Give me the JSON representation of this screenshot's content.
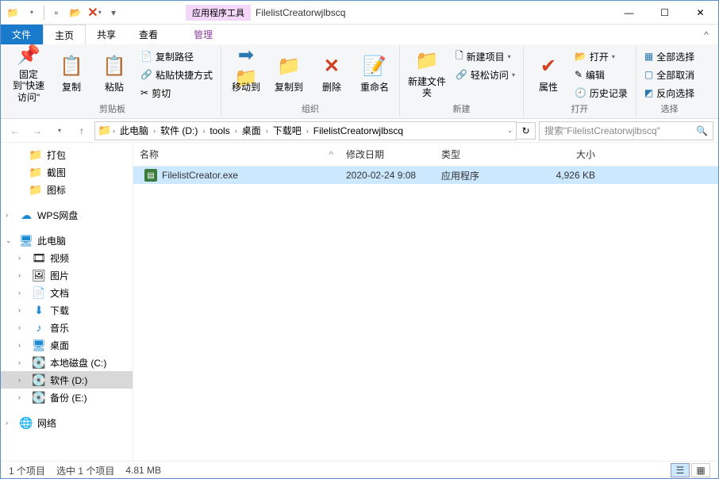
{
  "titlebar": {
    "tools_label": "应用程序工具",
    "title": "FilelistCreatorwjlbscq"
  },
  "tabs": {
    "file": "文件",
    "home": "主页",
    "share": "共享",
    "view": "查看",
    "manage": "管理"
  },
  "ribbon": {
    "pin": "固定到\"快速访问\"",
    "copy": "复制",
    "paste": "粘贴",
    "copy_path": "复制路径",
    "paste_shortcut": "粘贴快捷方式",
    "cut": "剪切",
    "clipboard_group": "剪贴板",
    "move_to": "移动到",
    "copy_to": "复制到",
    "delete": "删除",
    "rename": "重命名",
    "organize_group": "组织",
    "new_folder": "新建文件夹",
    "new_item": "新建项目",
    "easy_access": "轻松访问",
    "new_group": "新建",
    "properties": "属性",
    "open": "打开",
    "edit": "编辑",
    "history": "历史记录",
    "open_group": "打开",
    "select_all": "全部选择",
    "select_none": "全部取消",
    "invert": "反向选择",
    "select_group": "选择"
  },
  "breadcrumb": [
    "此电脑",
    "软件 (D:)",
    "tools",
    "桌面",
    "下载吧",
    "FilelistCreatorwjlbscq"
  ],
  "search": {
    "placeholder": "搜索\"FilelistCreatorwjlbscq\""
  },
  "nav": {
    "dabao": "打包",
    "jietu": "截图",
    "tubiao": "图标",
    "wps": "WPS网盘",
    "this_pc": "此电脑",
    "video": "视频",
    "pictures": "图片",
    "documents": "文档",
    "downloads": "下载",
    "music": "音乐",
    "desktop": "桌面",
    "disk_c": "本地磁盘 (C:)",
    "disk_d": "软件 (D:)",
    "disk_e": "备份 (E:)",
    "network": "网络"
  },
  "columns": {
    "name": "名称",
    "date": "修改日期",
    "type": "类型",
    "size": "大小"
  },
  "files": [
    {
      "name": "FilelistCreator.exe",
      "date": "2020-02-24 9:08",
      "type": "应用程序",
      "size": "4,926 KB"
    }
  ],
  "status": {
    "count": "1 个项目",
    "selection": "选中 1 个项目",
    "size": "4.81 MB"
  }
}
